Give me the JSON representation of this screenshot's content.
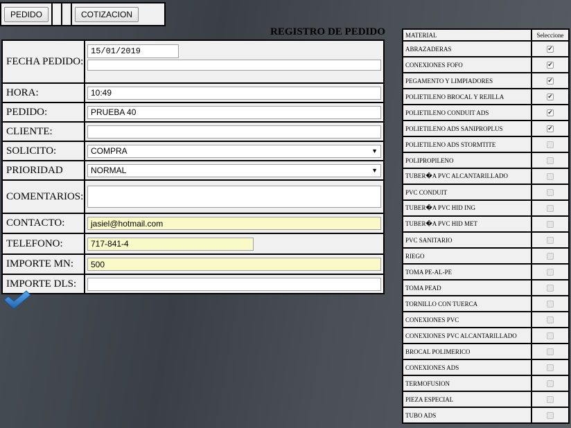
{
  "topbar": {
    "pedido_label": "PEDIDO",
    "cotizacion_label": "COTIZACION"
  },
  "title": "REGISTRO DE PEDIDO",
  "form": {
    "fecha_pedido": {
      "label": "FECHA PEDIDO:",
      "value": "15/01/2019"
    },
    "hora": {
      "label": "HORA:",
      "value": "10:49"
    },
    "pedido": {
      "label": "PEDIDO:",
      "value": "PRUEBA 40"
    },
    "cliente": {
      "label": "CLIENTE:",
      "value": ""
    },
    "solicito": {
      "label": "SOLICITO:",
      "value": "COMPRA"
    },
    "prioridad": {
      "label": "PRIORIDAD",
      "value": "NORMAL"
    },
    "comentarios": {
      "label": "COMENTARIOS:",
      "value": ""
    },
    "contacto": {
      "label": "CONTACTO:",
      "value": "jasiel@hotmail.com"
    },
    "telefono": {
      "label": "TELEFONO:",
      "value": "717-841-4"
    },
    "importe_mn": {
      "label": "IMPORTE MN:",
      "value": "500"
    },
    "importe_dls": {
      "label": "IMPORTE DLS:",
      "value": ""
    }
  },
  "materials": {
    "header_material": "MATERIAL",
    "header_select": "Seleccione",
    "items": [
      {
        "name": "ABRAZADERAS",
        "checked": true
      },
      {
        "name": "CONEXIONES FOFO",
        "checked": true
      },
      {
        "name": "PEGAMENTO Y LIMPIADORES",
        "checked": true
      },
      {
        "name": "POLIETILENO BROCAL Y REJILLA",
        "checked": true
      },
      {
        "name": "POLIETILENO CONDUIT ADS",
        "checked": true
      },
      {
        "name": "POLIETILENO ADS SANIPROPLUS",
        "checked": true
      },
      {
        "name": "POLIETILENO ADS STORMTITE",
        "checked": false
      },
      {
        "name": "POLIPROPILENO",
        "checked": false
      },
      {
        "name": "TUBER�A PVC ALCANTARILLADO",
        "checked": false
      },
      {
        "name": "PVC CONDUIT",
        "checked": false
      },
      {
        "name": "TUBER�A PVC HID ING",
        "checked": false
      },
      {
        "name": "TUBER�A PVC HID MET",
        "checked": false
      },
      {
        "name": "PVC SANITARIO",
        "checked": false
      },
      {
        "name": "RIEGO",
        "checked": false
      },
      {
        "name": "TOMA PE-AL-PE",
        "checked": false
      },
      {
        "name": "TOMA PEAD",
        "checked": false
      },
      {
        "name": "TORNILLO CON TUERCA",
        "checked": false
      },
      {
        "name": "CONEXIONES PVC",
        "checked": false
      },
      {
        "name": "CONEXIONES PVC ALCANTARILLADO",
        "checked": false
      },
      {
        "name": "BROCAL POLIMERICO",
        "checked": false
      },
      {
        "name": "CONEXIONES ADS",
        "checked": false
      },
      {
        "name": "TERMOFUSION",
        "checked": false
      },
      {
        "name": "PIEZA ESPECIAL",
        "checked": false
      },
      {
        "name": "TUBO ADS",
        "checked": false
      }
    ]
  },
  "icons": {
    "submit": "checkmark-icon",
    "select_arrow": "triangle-down-icon"
  },
  "colors": {
    "highlight_field": "#fafac8",
    "check_blue": "#2e7fc7"
  }
}
